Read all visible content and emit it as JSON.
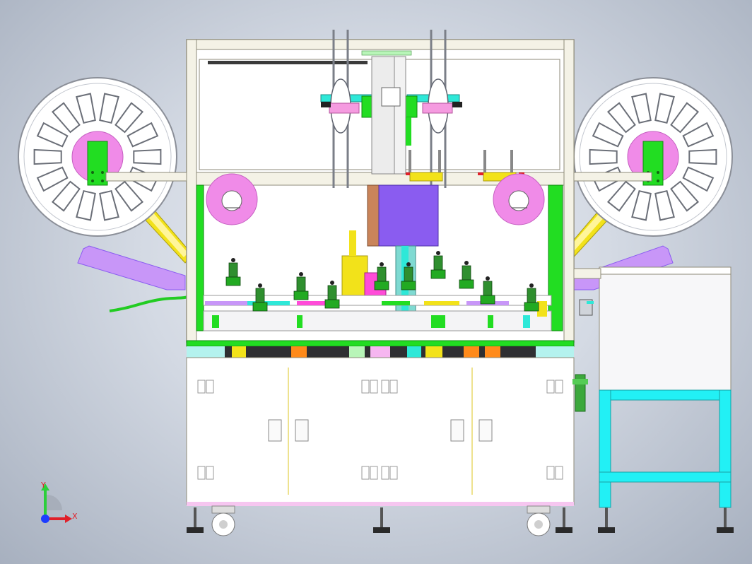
{
  "app": {
    "title": ""
  },
  "triad": {
    "x_label": "X",
    "y_label": "Y"
  },
  "colors": {
    "background_center": "#eef1f6",
    "background_edge": "#a7b0bf",
    "frame": "#f4f2e6",
    "panel": "#ffffff",
    "reel_pink": "#f08be8",
    "green": "#22dd22",
    "yellow": "#f2e21a",
    "purple": "#8a5cf0",
    "cyan": "#22f0f5",
    "orange": "#ff8a1a",
    "brown": "#c9845a",
    "magenta": "#ff4bd8",
    "triad_y": "#2bcf3a",
    "triad_x": "#e0202a",
    "triad_z": "#1c3cff"
  },
  "parts": {
    "left_reel": "left-reel",
    "right_reel": "right-reel",
    "main_frame": "main-frame",
    "side_cabinet": "side-cabinet",
    "cyan_stand": "cyan-stand"
  }
}
